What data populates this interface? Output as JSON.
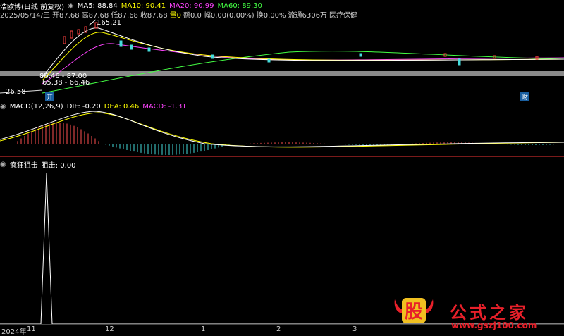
{
  "main_panel": {
    "stock_title": "浩欧博(日线 前复权)",
    "ma_labels": [
      {
        "text": "MA5: 88.84",
        "color": "#ffffff"
      },
      {
        "text": "MA10: 90.41",
        "color": "#ffff00"
      },
      {
        "text": "MA20: 90.99",
        "color": "#ff44ff"
      },
      {
        "text": "MA60: 89.30",
        "color": "#44ff44"
      }
    ],
    "info_line": {
      "date": "2025/05/14/三",
      "open": "开87.68",
      "high": "高87.68",
      "low": "低87.68",
      "close": "收87.68",
      "volume": "量0",
      "amount": "额0.0",
      "change": "幅0.00(0.00%)",
      "turnover": "换0.00%",
      "float": "流通6306万",
      "sector": "医疗保健"
    },
    "price_labels": {
      "peak": "165.21",
      "low": "26.58",
      "band_top": "86.46 - 87.00",
      "band_bottom": "65.38 - 66.46"
    },
    "markers": {
      "kai": "开",
      "cai": "财"
    }
  },
  "macd_panel": {
    "label": "MACD(12,26,9)",
    "dif": "DIF: -0.20",
    "dea": "DEA: 0.46",
    "macd": "MACD: -1.31",
    "colors": {
      "dif": "#ffffff",
      "dea": "#ffff00",
      "macd": "#ff44ff"
    }
  },
  "indicator_panel": {
    "title": "疯狂狙击",
    "value": "狙击: 0.00"
  },
  "time_axis": {
    "ticks": [
      "2024年",
      "11",
      "12",
      "1",
      "2",
      "3"
    ]
  },
  "watermark": {
    "stock_char": "股",
    "site": "公式之家",
    "url": "www.gszj100.com"
  }
}
